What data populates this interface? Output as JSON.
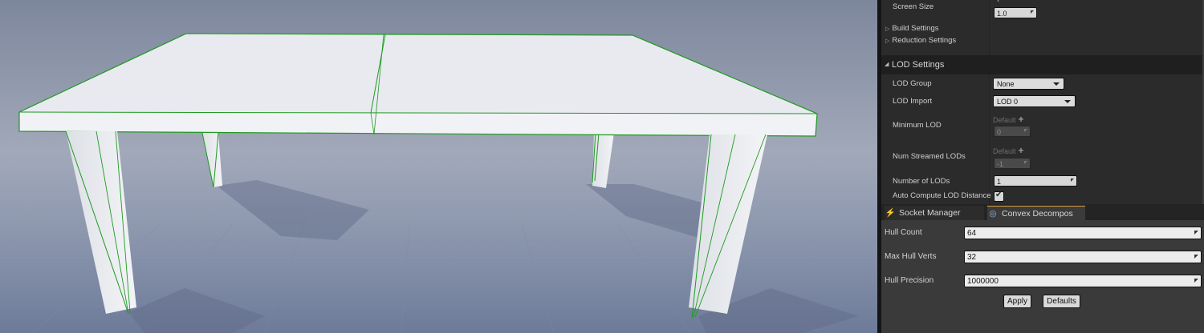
{
  "details": {
    "partial_top_label": "Screen Size",
    "screen_size": "1.0",
    "build_settings": "Build Settings",
    "reduction_settings": "Reduction Settings",
    "lod_section_title": "LOD Settings",
    "lod_group_label": "LOD Group",
    "lod_group_value": "None",
    "lod_import_label": "LOD Import",
    "lod_import_value": "LOD 0",
    "minimum_lod_label": "Minimum LOD",
    "minimum_lod_default": "Default",
    "minimum_lod_value": "0",
    "num_streamed_lods_label": "Num Streamed LODs",
    "num_streamed_lods_default": "Default",
    "num_streamed_lods_value": "-1",
    "number_of_lods_label": "Number of LODs",
    "number_of_lods_value": "1",
    "auto_compute_label": "Auto Compute LOD Distance",
    "auto_compute_checked": true
  },
  "tabs": [
    {
      "label": "Socket Manager",
      "icon": "socket-icon",
      "active": false
    },
    {
      "label": "Convex Decompos",
      "icon": "convex-icon",
      "active": true
    }
  ],
  "convex": {
    "hull_count_label": "Hull Count",
    "hull_count_value": "64",
    "max_hull_verts_label": "Max Hull Verts",
    "max_hull_verts_value": "32",
    "hull_precision_label": "Hull Precision",
    "hull_precision_value": "1000000",
    "apply_label": "Apply",
    "defaults_label": "Defaults"
  },
  "colors": {
    "viewport_sky": "#9aa3b8",
    "collision_wire": "#1f9a1f",
    "accent_tab": "#e0a040"
  }
}
